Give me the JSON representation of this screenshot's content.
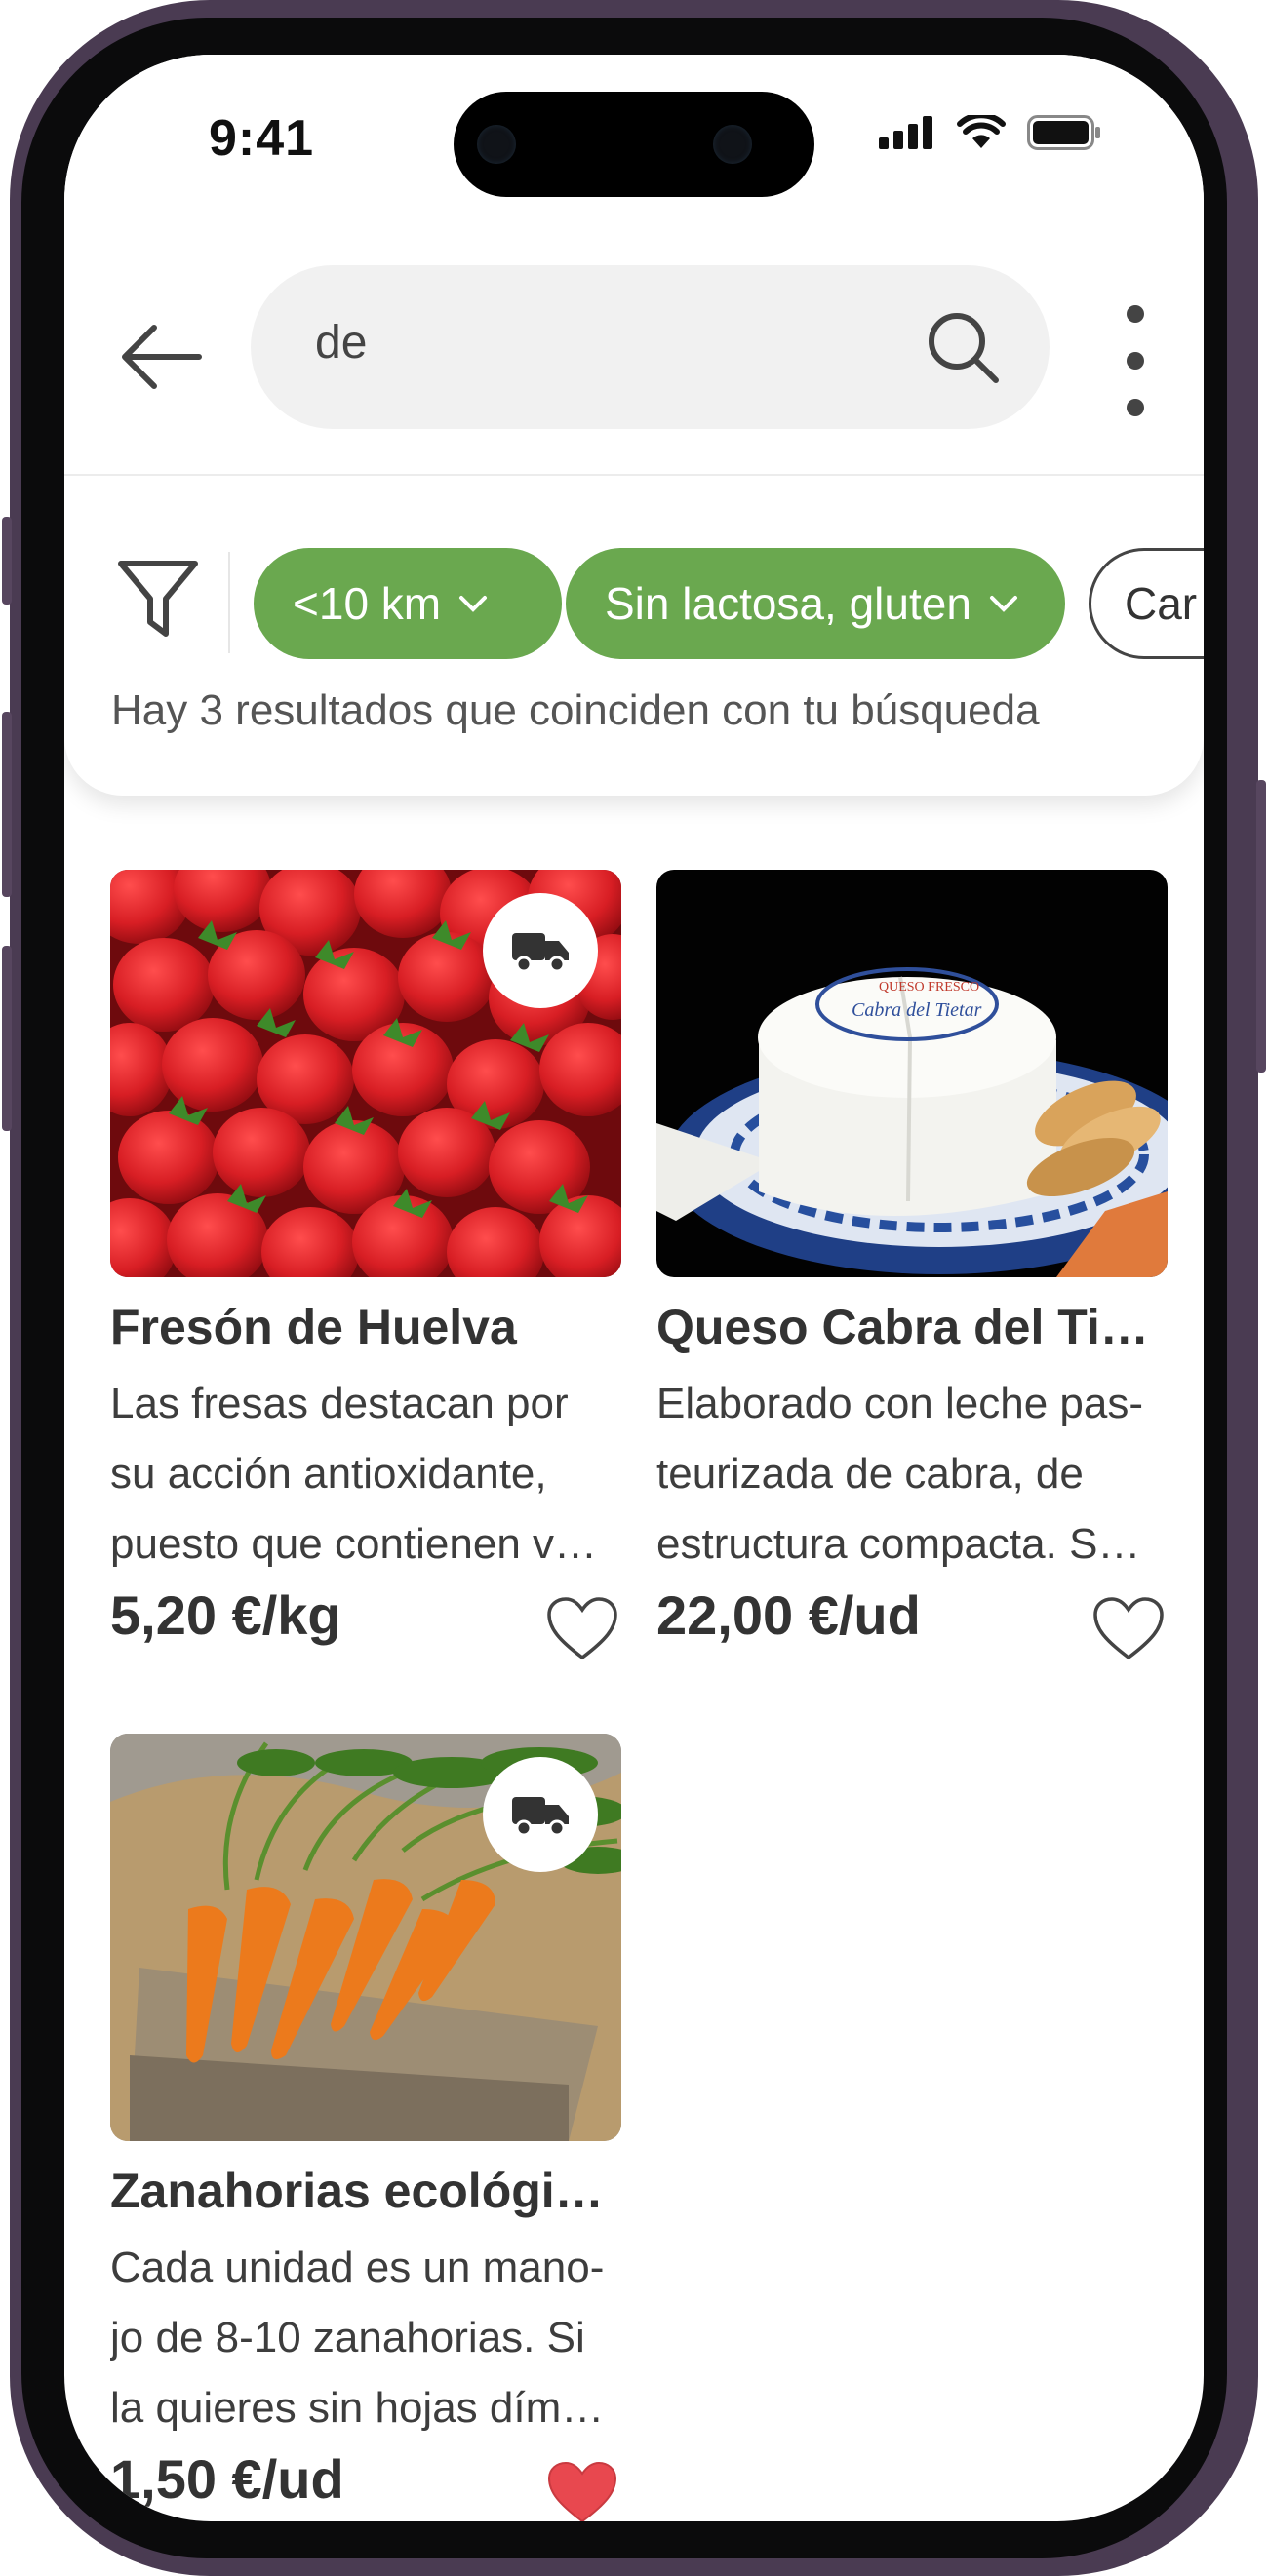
{
  "status_bar": {
    "time": "9:41"
  },
  "search": {
    "value": "de"
  },
  "filters": {
    "chips": [
      {
        "label": "<10 km",
        "state": "active"
      },
      {
        "label": "Sin lactosa, gluten",
        "state": "active"
      },
      {
        "label": "Car",
        "state": "inactive"
      }
    ],
    "results_text": "Hay 3 resultados que coinciden con tu búsqueda"
  },
  "products": [
    {
      "title": "Fresón de Huelva",
      "description": "Las fresas destacan por su acción antioxidante, puesto que contienen v…",
      "price": "5,20 €/kg",
      "delivery_badge": true,
      "favorite": false,
      "image": "strawberries-photo"
    },
    {
      "title": "Queso Cabra del Ti…",
      "description": "Elaborado con leche pas-teurizada de cabra, de estructura compacta. S…",
      "price": "22,00 €/ud",
      "delivery_badge": false,
      "favorite": false,
      "image": "goat-cheese-photo",
      "image_label_1": "QUESO FRESCO",
      "image_label_2": "Cabra del Tietar"
    },
    {
      "title": "Zanahorias ecológic…",
      "description": "Cada unidad es un mano-jo de 8-10 zanahorias. Si la quieres sin hojas dím…",
      "price": "1,50 €/ud",
      "delivery_badge": true,
      "favorite": true,
      "image": "carrots-photo"
    }
  ],
  "colors": {
    "accent": "#6aa84f",
    "favorite": "#e8484f",
    "frame": "#4a3b52"
  }
}
